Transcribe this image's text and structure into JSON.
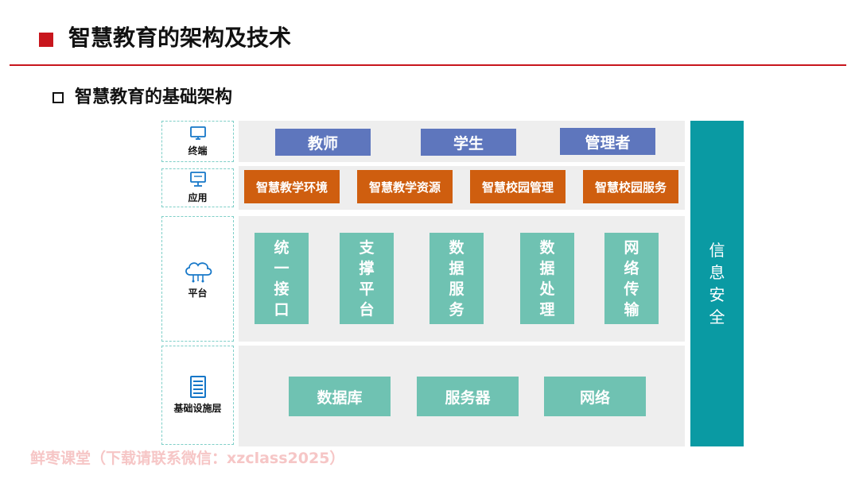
{
  "title": "智慧教育的架构及技术",
  "subtitle": "智慧教育的基础架构",
  "layers": {
    "terminal": {
      "label": "终端",
      "icon": "monitor-icon",
      "items": [
        "教师",
        "学生",
        "管理者"
      ]
    },
    "application": {
      "label": "应用",
      "icon": "computer-icon",
      "items": [
        "智慧教学环境",
        "智慧教学资源",
        "智慧校园管理",
        "智慧校园服务"
      ]
    },
    "platform": {
      "label": "平台",
      "icon": "cloud-icon",
      "items": [
        "统一接口",
        "支撑平台",
        "数据服务",
        "数据处理",
        "网络传输"
      ]
    },
    "infrastructure": {
      "label": "基础设施层",
      "icon": "server-icon",
      "items": [
        "数据库",
        "服务器",
        "网络"
      ]
    }
  },
  "security": "信息安全",
  "watermark": "鲜枣课堂（下载请联系微信：xzclass2025）",
  "colors": {
    "accent_red": "#c8161d",
    "terminal_box": "#5e76bd",
    "application_box": "#cf5e0f",
    "platform_box": "#6fc2b2",
    "security_bar": "#0a9aa3",
    "layer_background": "#eeeeee"
  }
}
